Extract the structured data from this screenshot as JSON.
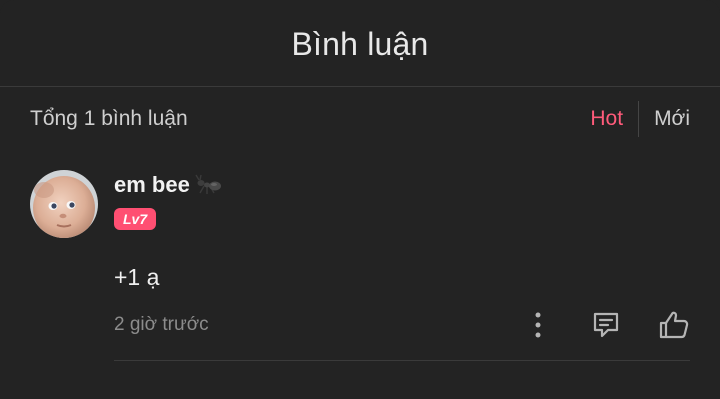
{
  "header": {
    "title": "Bình luận"
  },
  "subbar": {
    "count_text": "Tổng 1 bình luận",
    "sort_options": [
      "Hot",
      "Mới"
    ],
    "active_sort": "Hot",
    "active_color": "#ff5b7a"
  },
  "comments": [
    {
      "username": "em bee",
      "level": "Lv7",
      "level_color": "#ff4f72",
      "content": "+1 ạ",
      "time": "2 giờ trước",
      "icons": [
        "ant-icon",
        "more-vertical-icon",
        "reply-comment-icon",
        "thumbs-up-icon"
      ]
    }
  ]
}
